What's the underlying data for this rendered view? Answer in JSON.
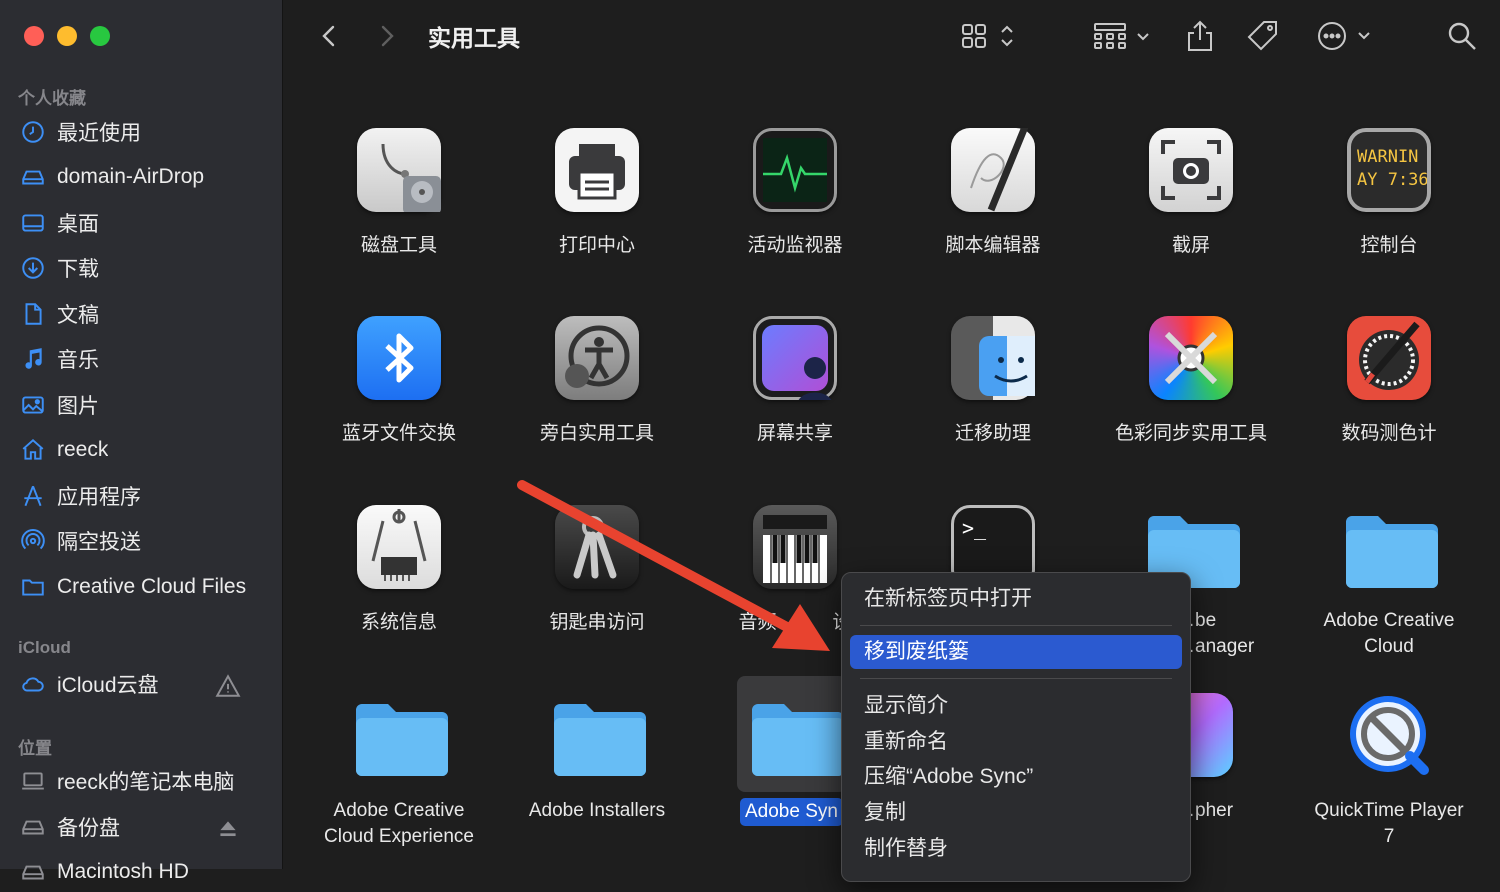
{
  "window": {
    "title": "实用工具"
  },
  "sidebar": {
    "favorites_title": "个人收藏",
    "favorites": [
      {
        "label": "最近使用",
        "icon": "clock-icon"
      },
      {
        "label": "domain-AirDrop",
        "icon": "drive-icon"
      },
      {
        "label": "桌面",
        "icon": "desktop-icon"
      },
      {
        "label": "下载",
        "icon": "download-icon"
      },
      {
        "label": "文稿",
        "icon": "document-icon"
      },
      {
        "label": "音乐",
        "icon": "music-icon"
      },
      {
        "label": "图片",
        "icon": "photo-icon"
      },
      {
        "label": "reeck",
        "icon": "home-icon"
      },
      {
        "label": "应用程序",
        "icon": "applications-icon"
      },
      {
        "label": "隔空投送",
        "icon": "airdrop-icon"
      },
      {
        "label": "Creative Cloud Files",
        "icon": "folder-icon"
      }
    ],
    "icloud_title": "iCloud",
    "icloud": [
      {
        "label": "iCloud云盘",
        "icon": "cloud-icon",
        "trailing": "warning-icon"
      }
    ],
    "locations_title": "位置",
    "locations": [
      {
        "label": "reeck的笔记本电脑",
        "icon": "laptop-icon"
      },
      {
        "label": "备份盘",
        "icon": "drive-icon",
        "trailing": "eject-icon"
      },
      {
        "label": "Macintosh HD",
        "icon": "drive-icon"
      }
    ]
  },
  "toolbar": {
    "back_icon": "chevron-left-icon",
    "forward_icon": "chevron-right-icon",
    "view_icon": "grid-view-icon",
    "group_icon": "group-icon",
    "share_icon": "share-icon",
    "tag_icon": "tag-icon",
    "more_icon": "ellipsis-circle-icon",
    "search_icon": "search-icon"
  },
  "items": [
    {
      "name": "磁盘工具",
      "icon": "disk-utility-icon"
    },
    {
      "name": "打印中心",
      "icon": "print-center-icon"
    },
    {
      "name": "活动监视器",
      "icon": "activity-monitor-icon"
    },
    {
      "name": "脚本编辑器",
      "icon": "script-editor-icon"
    },
    {
      "name": "截屏",
      "icon": "screenshot-icon"
    },
    {
      "name": "控制台",
      "icon": "console-icon",
      "icon_text1": "WARNIN",
      "icon_text2": "AY 7:36"
    },
    {
      "name": "蓝牙文件交换",
      "icon": "bluetooth-icon"
    },
    {
      "name": "旁白实用工具",
      "icon": "voiceover-icon"
    },
    {
      "name": "屏幕共享",
      "icon": "screen-sharing-icon"
    },
    {
      "name": "迁移助理",
      "icon": "migration-assistant-icon"
    },
    {
      "name": "色彩同步实用工具",
      "icon": "colorsync-icon"
    },
    {
      "name": "数码测色计",
      "icon": "digital-color-meter-icon"
    },
    {
      "name": "系统信息",
      "icon": "system-information-icon"
    },
    {
      "name": "钥匙串访问",
      "icon": "keychain-icon"
    },
    {
      "name": "音频",
      "name_tail": "设",
      "icon": "audio-midi-icon"
    },
    {
      "name": "",
      "icon": "terminal-icon",
      "icon_text": ">_"
    },
    {
      "name": "…be",
      "name2": "…anager",
      "icon": "folder-icon"
    },
    {
      "name": "Adobe Creative",
      "name2": "Cloud",
      "icon": "folder-icon"
    },
    {
      "name": "Adobe Creative",
      "name2": "Cloud Experience",
      "icon": "folder-icon"
    },
    {
      "name": "Adobe Installers",
      "icon": "folder-icon"
    },
    {
      "name": "Adobe Syn",
      "icon": "folder-icon",
      "selected": true
    },
    {
      "name": "…pher",
      "icon": "grapher-icon"
    },
    {
      "name": "QuickTime Player",
      "name2": "7",
      "icon": "quicktime-icon"
    }
  ],
  "context_menu": {
    "items": [
      {
        "label": "在新标签页中打开"
      },
      {
        "label": "移到废纸篓",
        "highlighted": true
      },
      {
        "label": "显示简介"
      },
      {
        "label": "重新命名"
      },
      {
        "label": "压缩“Adobe Sync”"
      },
      {
        "label": "复制"
      },
      {
        "label": "制作替身"
      }
    ]
  },
  "colors": {
    "selection": "#2b5ad0",
    "folder": "#5eb7f0",
    "arrow": "#e8432f"
  }
}
